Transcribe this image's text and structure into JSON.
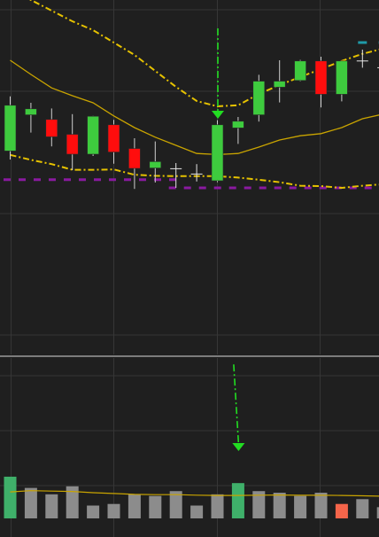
{
  "colors": {
    "background": "#1f1f1f",
    "grid": "#363636",
    "separator": "#d9d9d9",
    "bullish": "#3ecb3e",
    "bearish": "#ff0d0d",
    "doji": "#e6e6e6",
    "yellow": "#e6c200",
    "ma_line": "#c9a400",
    "annotation": "#22dd22",
    "support": "#8a1aa0",
    "marker": "#1f9aa8",
    "volume_gray": "#8c8c8c",
    "volume_green": "#3fb06a",
    "volume_orange": "#f5654a"
  },
  "chart_data": [
    {
      "type": "candlestick",
      "title": "",
      "xlabel": "",
      "ylabel": "",
      "ylim": [
        0,
        100
      ],
      "grid": true,
      "legend": "none",
      "candles": [
        {
          "o": 57.4,
          "h": 72.8,
          "l": 55.0,
          "c": 70.3
        },
        {
          "o": 67.6,
          "h": 71.0,
          "l": 62.6,
          "c": 69.3
        },
        {
          "o": 66.3,
          "h": 69.4,
          "l": 58.7,
          "c": 61.4
        },
        {
          "o": 62.1,
          "h": 67.8,
          "l": 52.0,
          "c": 56.5
        },
        {
          "o": 56.5,
          "h": 67.3,
          "l": 56.0,
          "c": 67.2
        },
        {
          "o": 64.8,
          "h": 66.2,
          "l": 53.8,
          "c": 57.1
        },
        {
          "o": 58.1,
          "h": 61.0,
          "l": 46.7,
          "c": 52.5
        },
        {
          "o": 52.6,
          "h": 60.1,
          "l": 48.5,
          "c": 54.4
        },
        {
          "o": 52.4,
          "h": 54.0,
          "l": 47.0,
          "c": 52.4
        },
        {
          "o": 50.9,
          "h": 53.7,
          "l": 48.8,
          "c": 50.9
        },
        {
          "o": 49.0,
          "h": 66.1,
          "l": 48.6,
          "c": 64.8
        },
        {
          "o": 63.9,
          "h": 67.0,
          "l": 59.4,
          "c": 65.8
        },
        {
          "o": 67.6,
          "h": 78.9,
          "l": 65.7,
          "c": 77.1
        },
        {
          "o": 75.4,
          "h": 83.0,
          "l": 71.1,
          "c": 77.1
        },
        {
          "o": 77.3,
          "h": 83.1,
          "l": 77.1,
          "c": 82.8
        },
        {
          "o": 82.8,
          "h": 84.0,
          "l": 69.7,
          "c": 73.4
        },
        {
          "o": 73.4,
          "h": 82.8,
          "l": 71.4,
          "c": 82.8
        },
        {
          "o": 82.8,
          "h": 86.0,
          "l": 80.9,
          "c": 82.8
        },
        {
          "o": 80.9,
          "h": 82.6,
          "l": 79.4,
          "c": 80.9
        }
      ],
      "upper_band": [
        103.0,
        100.0,
        97.0,
        94.0,
        91.5,
        88.0,
        84.5,
        80.0,
        75.5,
        71.5,
        70.0,
        70.3,
        73.5,
        76.0,
        78.3,
        80.5,
        82.8,
        84.8,
        86.3
      ],
      "middle_line": [
        83.0,
        79.0,
        75.2,
        73.0,
        71.0,
        67.3,
        64.0,
        61.3,
        59.0,
        56.7,
        56.4,
        56.7,
        58.5,
        60.5,
        61.7,
        62.3,
        64.0,
        66.5,
        67.8
      ],
      "lower_band": [
        56.3,
        54.9,
        53.7,
        52.1,
        52.1,
        52.2,
        50.7,
        50.4,
        50.3,
        50.3,
        50.3,
        49.9,
        49.3,
        48.6,
        47.6,
        47.5,
        47.0,
        47.6,
        48.0
      ],
      "support_levels": [
        {
          "value": 49.3,
          "from": 0,
          "to": 8
        },
        {
          "value": 47.0,
          "from": 8,
          "to": 19
        }
      ],
      "annotation_arrow": {
        "index": 10,
        "from": 92.0,
        "to": 68.5
      },
      "markers": [
        {
          "index": 17,
          "value": 88.0
        },
        {
          "index": 18,
          "value": 88.0
        }
      ]
    },
    {
      "type": "bar",
      "title": "",
      "xlabel": "",
      "ylabel": "",
      "ylim": [
        0,
        100
      ],
      "grid": true,
      "legend": "none",
      "values": [
        26,
        19,
        15,
        20,
        8,
        9,
        15,
        14,
        17,
        8,
        15,
        22,
        17,
        16,
        14,
        16,
        9,
        12,
        7
      ],
      "highlight": {
        "0": "volume_green",
        "11": "volume_green",
        "16": "volume_orange"
      },
      "average_line": [
        16.5,
        17.3,
        17.0,
        16.8,
        16.0,
        15.5,
        15.0,
        14.8,
        14.8,
        14.5,
        14.3,
        14.3,
        14.5,
        14.6,
        14.4,
        14.4,
        14.3,
        14.1,
        13.8
      ],
      "annotation_arrow": {
        "index": 11,
        "from": 96.0,
        "to": 42.0
      }
    }
  ]
}
